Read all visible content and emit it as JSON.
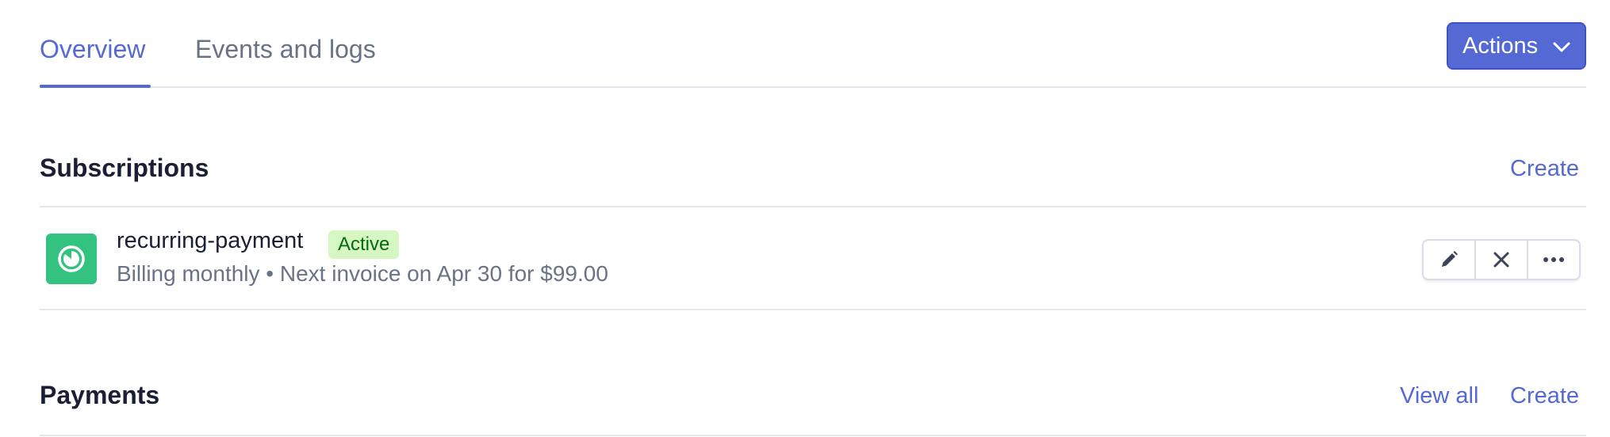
{
  "tabs": [
    {
      "label": "Overview",
      "active": true
    },
    {
      "label": "Events and logs",
      "active": false
    }
  ],
  "header": {
    "actions_label": "Actions"
  },
  "subscriptions": {
    "title": "Subscriptions",
    "create_label": "Create",
    "items": [
      {
        "name": "recurring-payment",
        "status": "Active",
        "meta": "Billing monthly • Next invoice on Apr 30 for $99.00",
        "icon": "subscription-icon",
        "row_actions": [
          "edit-icon",
          "cancel-icon",
          "more-icon"
        ]
      }
    ]
  },
  "payments": {
    "title": "Payments",
    "view_all_label": "View all",
    "create_label": "Create"
  },
  "colors": {
    "accent": "#5469d4",
    "badge_bg": "#d7f7c2",
    "badge_text": "#05690d",
    "icon_bg": "#33c27f"
  }
}
